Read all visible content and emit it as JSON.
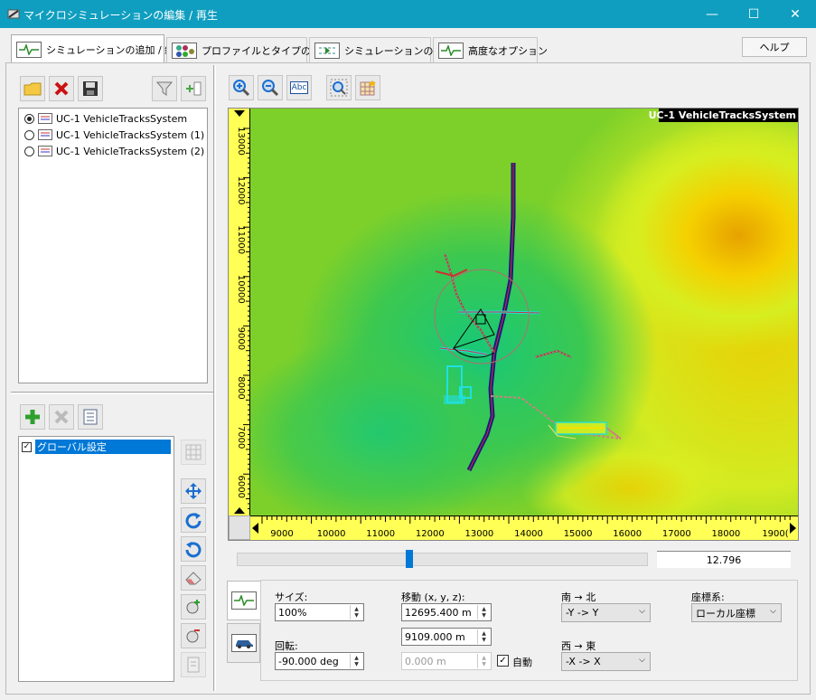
{
  "window": {
    "title": "マイクロシミュレーションの編集 / 再生",
    "minimize": "—",
    "maximize": "☐",
    "close": "✕"
  },
  "tabs": [
    {
      "label": "シミュレーションの追加 / 編集",
      "active": true
    },
    {
      "label": "プロファイルとタイプの管理"
    },
    {
      "label": "シミュレーションの再生"
    },
    {
      "label": "高度なオプション"
    }
  ],
  "help_button": "ヘルプ",
  "simulations": [
    {
      "label": "UC-1 VehicleTracksSystem",
      "selected": true
    },
    {
      "label": "UC-1 VehicleTracksSystem (1)"
    },
    {
      "label": "UC-1 VehicleTracksSystem (2)"
    }
  ],
  "settings_list": [
    {
      "label": "グローバル設定",
      "checked": true
    }
  ],
  "map": {
    "overlay_title": "UC-1 VehicleTracksSystem",
    "y_ticks": [
      "13000",
      "12000",
      "11000",
      "10000",
      "9000",
      "8000",
      "7000",
      "6000"
    ],
    "x_ticks": [
      "9000",
      "10000",
      "11000",
      "12000",
      "13000",
      "14000",
      "15000",
      "16000",
      "17000",
      "18000",
      "1900("
    ],
    "zoom_toolbar_text": "Abc"
  },
  "slider": {
    "value": "12.796",
    "position_fraction": 0.42
  },
  "transform": {
    "size_label": "サイズ:",
    "size_value": "100%",
    "rotation_label": "回転:",
    "rotation_value": "-90.000 deg",
    "move_label": "移動 (x, y, z):",
    "move_x": "12695.400 m",
    "move_y": "9109.000 m",
    "move_z": "0.000 m",
    "auto_label": "自動",
    "ns_label": "南 → 北",
    "ns_value": "-Y -> Y",
    "we_label": "西 → 東",
    "we_value": "-X -> X",
    "coord_label": "座標系:",
    "coord_value": "ローカル座標"
  },
  "colors": {
    "titlebar": "#0f9ebf",
    "ruler": "#ffff55",
    "track": "#1a1a80",
    "accent": "#0078d7"
  }
}
